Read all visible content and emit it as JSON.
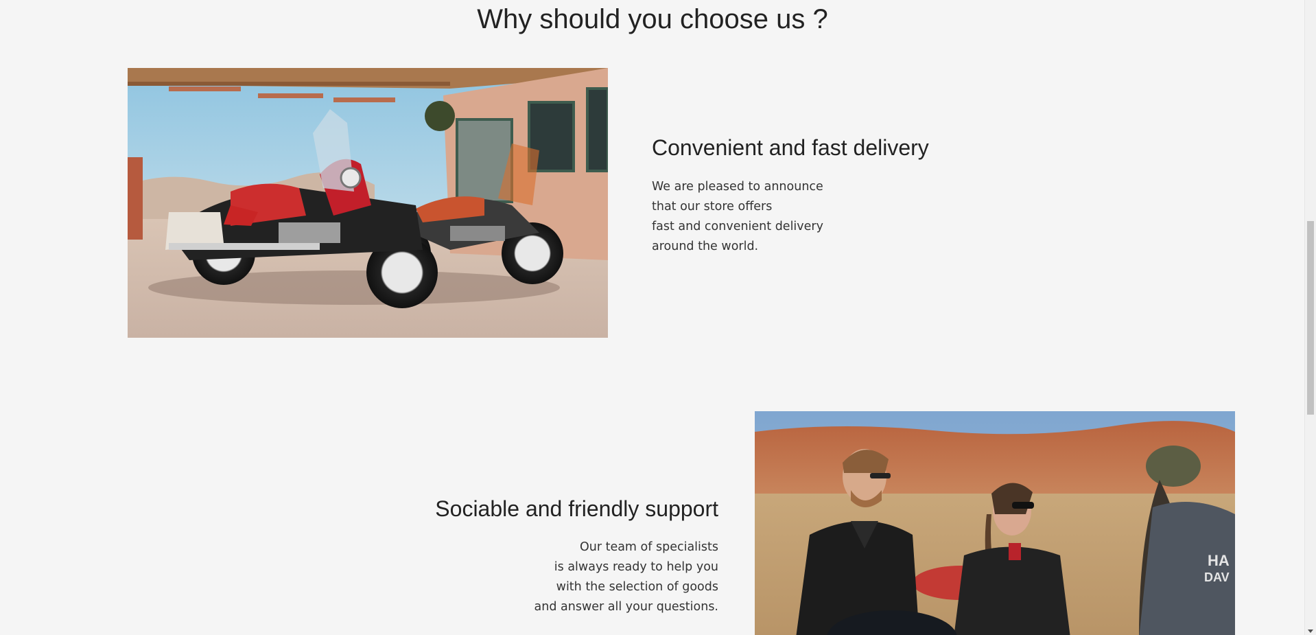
{
  "section": {
    "title": "Why should you choose us ?"
  },
  "features": [
    {
      "title": "Convenient and fast delivery",
      "lines": [
        "We are pleased to announce",
        "that our store offers",
        "fast and convenient delivery",
        "around the world."
      ],
      "image": "motorcycles-at-gas-station"
    },
    {
      "title": "Sociable and friendly support",
      "lines": [
        "Our team of specialists",
        "is always ready to help you",
        "with the selection of goods",
        "and answer all your questions."
      ],
      "image": "bikers-in-leather-jackets"
    }
  ],
  "colors": {
    "background": "#f5f5f5",
    "text": "#222222"
  }
}
